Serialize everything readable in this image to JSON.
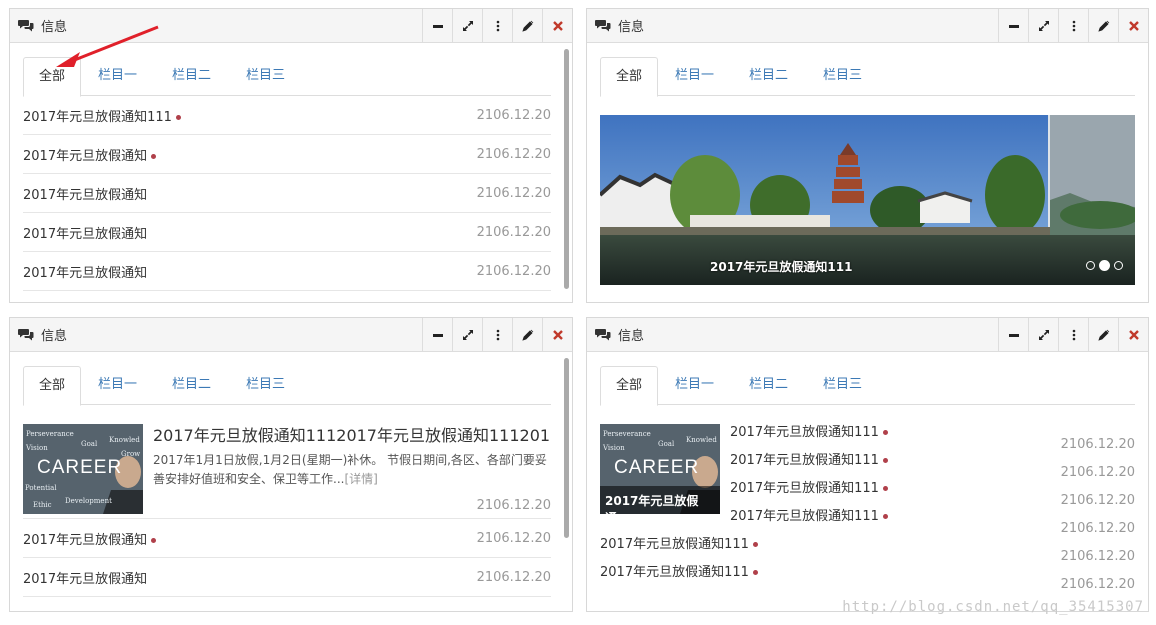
{
  "panels": [
    {
      "title": "信息",
      "tabs": [
        "全部",
        "栏目一",
        "栏目二",
        "栏目三"
      ],
      "rows": [
        {
          "title": "2017年元旦放假通知111",
          "date": "2106.12.20"
        },
        {
          "title": "2017年元旦放假通知",
          "date": "2106.12.20"
        },
        {
          "title": "2017年元旦放假通知",
          "date": "2106.12.20"
        },
        {
          "title": "2017年元旦放假通知",
          "date": "2106.12.20"
        },
        {
          "title": "2017年元旦放假通知",
          "date": "2106.12.20"
        }
      ]
    },
    {
      "title": "信息",
      "tabs": [
        "全部",
        "栏目一",
        "栏目二",
        "栏目三"
      ],
      "carousel_caption": "2017年元旦放假通知111"
    },
    {
      "title": "信息",
      "tabs": [
        "全部",
        "栏目一",
        "栏目二",
        "栏目三"
      ],
      "featured": {
        "title": "2017年元旦放假通知1112017年元旦放假通知111201…",
        "summary": "2017年1月1日放假,1月2日(星期一)补休。 节假日期间,各区、各部门要妥善安排好值班和安全、保卫等工作...",
        "more": "[详情]",
        "date": "2106.12.20"
      },
      "rows": [
        {
          "title": "2017年元旦放假通知",
          "date": "2106.12.20"
        },
        {
          "title": "2017年元旦放假通知",
          "date": "2106.12.20"
        }
      ]
    },
    {
      "title": "信息",
      "tabs": [
        "全部",
        "栏目一",
        "栏目二",
        "栏目三"
      ],
      "image_caption": "2017年元旦放假通...",
      "items": [
        "2017年元旦放假通知111",
        "2017年元旦放假通知111",
        "2017年元旦放假通知111",
        "2017年元旦放假通知111",
        "2017年元旦放假通知111",
        "2017年元旦放假通知111"
      ],
      "dates": [
        "2106.12.20",
        "2106.12.20",
        "2106.12.20",
        "2106.12.20",
        "2106.12.20",
        "2106.12.20"
      ]
    }
  ],
  "career_image": {
    "word": "CAREER",
    "words": [
      "Perseverance",
      "Goal",
      "Knowled",
      "Vision",
      "Grow",
      "Potential",
      "Ethic",
      "Development",
      "Responsibility"
    ]
  },
  "watermark": "http://blog.csdn.net/qq_35415307",
  "colors": {
    "accent": "#3c79b5",
    "dot": "#b0404a",
    "close": "#c0392b"
  }
}
